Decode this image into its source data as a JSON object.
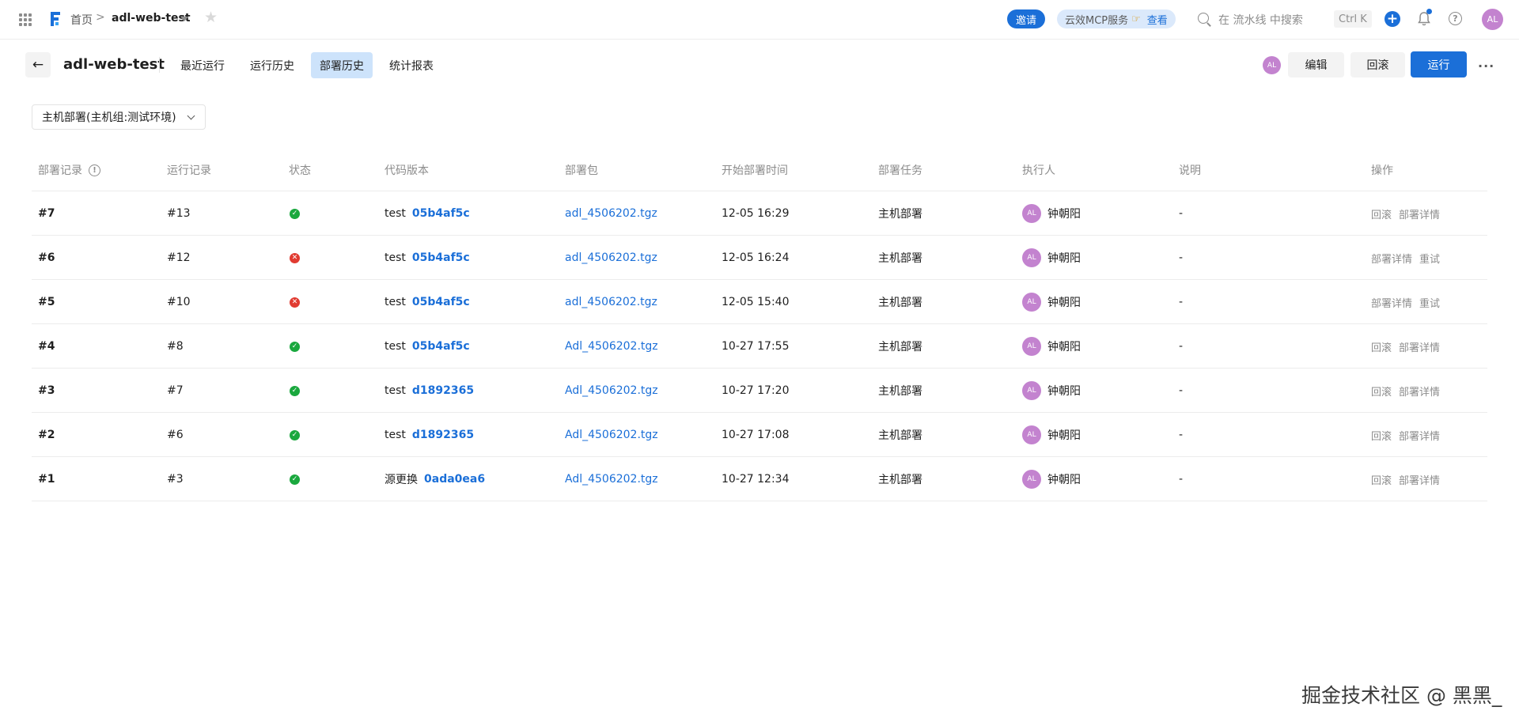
{
  "topbar": {
    "home": "首页",
    "separator": ">",
    "project": "adl-web-test",
    "invite": "邀请",
    "mcp_text": "云效MCP服务",
    "mcp_view": "查看",
    "search_placeholder": "在 流水线 中搜索",
    "shortcut": "Ctrl K",
    "plus": "+",
    "help": "?",
    "avatar": "AL",
    "icons": [
      "apps-icon",
      "logo-icon",
      "chevron-down-icon",
      "star-icon",
      "hand-icon",
      "search-icon",
      "plus-icon",
      "bell-icon",
      "help-icon"
    ]
  },
  "header": {
    "back": "←",
    "title": "adl-web-test",
    "tabs": [
      {
        "label": "最近运行",
        "active": false
      },
      {
        "label": "运行历史",
        "active": false
      },
      {
        "label": "部署历史",
        "active": true
      },
      {
        "label": "统计报表",
        "active": false
      }
    ],
    "avatar": "AL",
    "edit": "编辑",
    "rollback": "回滚",
    "run": "运行",
    "more": "···"
  },
  "filter": {
    "value": "主机部署(主机组:测试环境)"
  },
  "table": {
    "columns": [
      "部署记录",
      "运行记录",
      "状态",
      "代码版本",
      "部署包",
      "开始部署时间",
      "部署任务",
      "执行人",
      "说明",
      "操作"
    ],
    "info_icon": "!",
    "rows": [
      {
        "deploy": "#7",
        "run": "#13",
        "status": "success",
        "branch": "test",
        "commit": "05b4af5c",
        "package": "adl_4506202.tgz",
        "time": "12-05 16:29",
        "task": "主机部署",
        "avatar": "AL",
        "executor": "钟朝阳",
        "note": "-",
        "actions": [
          "回滚",
          "部署详情"
        ]
      },
      {
        "deploy": "#6",
        "run": "#12",
        "status": "failed",
        "branch": "test",
        "commit": "05b4af5c",
        "package": "adl_4506202.tgz",
        "time": "12-05 16:24",
        "task": "主机部署",
        "avatar": "AL",
        "executor": "钟朝阳",
        "note": "-",
        "actions": [
          "部署详情",
          "重试"
        ]
      },
      {
        "deploy": "#5",
        "run": "#10",
        "status": "failed",
        "branch": "test",
        "commit": "05b4af5c",
        "package": "adl_4506202.tgz",
        "time": "12-05 15:40",
        "task": "主机部署",
        "avatar": "AL",
        "executor": "钟朝阳",
        "note": "-",
        "actions": [
          "部署详情",
          "重试"
        ]
      },
      {
        "deploy": "#4",
        "run": "#8",
        "status": "success",
        "branch": "test",
        "commit": "05b4af5c",
        "package": "Adl_4506202.tgz",
        "time": "10-27 17:55",
        "task": "主机部署",
        "avatar": "AL",
        "executor": "钟朝阳",
        "note": "-",
        "actions": [
          "回滚",
          "部署详情"
        ]
      },
      {
        "deploy": "#3",
        "run": "#7",
        "status": "success",
        "branch": "test",
        "commit": "d1892365",
        "package": "Adl_4506202.tgz",
        "time": "10-27 17:20",
        "task": "主机部署",
        "avatar": "AL",
        "executor": "钟朝阳",
        "note": "-",
        "actions": [
          "回滚",
          "部署详情"
        ]
      },
      {
        "deploy": "#2",
        "run": "#6",
        "status": "success",
        "branch": "test",
        "commit": "d1892365",
        "package": "Adl_4506202.tgz",
        "time": "10-27 17:08",
        "task": "主机部署",
        "avatar": "AL",
        "executor": "钟朝阳",
        "note": "-",
        "actions": [
          "回滚",
          "部署详情"
        ]
      },
      {
        "deploy": "#1",
        "run": "#3",
        "status": "success",
        "branch": "源更换",
        "commit": "0ada0ea6",
        "package": "Adl_4506202.tgz",
        "time": "10-27 12:34",
        "task": "主机部署",
        "avatar": "AL",
        "executor": "钟朝阳",
        "note": "-",
        "actions": [
          "回滚",
          "部署详情"
        ]
      }
    ]
  },
  "status_glyphs": {
    "success": "✓",
    "failed": "✕"
  },
  "colors": {
    "brand": "#1b6fd8",
    "success": "#1aa83e",
    "failed": "#e13b31",
    "avatar": "#c383cf",
    "tab_active": "#cde3fb"
  },
  "watermark": "掘金技术社区 @ 黑黑_"
}
